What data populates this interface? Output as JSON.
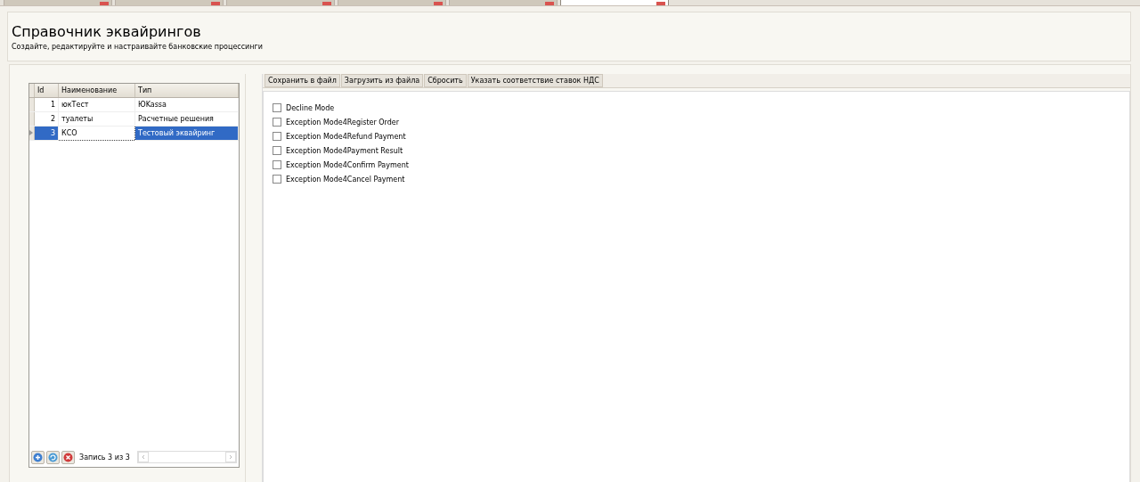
{
  "tabs": [
    {
      "selected": false
    },
    {
      "selected": false
    },
    {
      "selected": false
    },
    {
      "selected": false
    },
    {
      "selected": false
    },
    {
      "selected": true
    }
  ],
  "header": {
    "title": "Справочник эквайрингов",
    "subtitle": "Создайте, редактируйте и настраивайте банковские процессинги"
  },
  "table": {
    "columns": [
      "Id",
      "Наименование",
      "Тип"
    ],
    "rows": [
      {
        "cells": [
          "1",
          "юкТест",
          "ЮKassa"
        ],
        "selected": false
      },
      {
        "cells": [
          "2",
          "туалеты",
          "Расчетные решения"
        ],
        "selected": false
      },
      {
        "cells": [
          "3",
          "КСО",
          "Тестовый эквайринг"
        ],
        "selected": true
      }
    ]
  },
  "navigator": {
    "record": "Запись 3 из 3"
  },
  "toolbar": [
    "Сохранить в файл",
    "Загрузить из файла",
    "Сбросить",
    "Указать соответствие ставок НДС"
  ],
  "options": [
    {
      "label": "Decline Mode",
      "checked": false
    },
    {
      "label": "Exception Mode4Register Order",
      "checked": false
    },
    {
      "label": "Exception Mode4Refund Payment",
      "checked": false
    },
    {
      "label": "Exception Mode4Payment Result",
      "checked": false
    },
    {
      "label": "Exception Mode4Confirm Payment",
      "checked": false
    },
    {
      "label": "Exception Mode4Cancel Payment",
      "checked": false
    }
  ]
}
